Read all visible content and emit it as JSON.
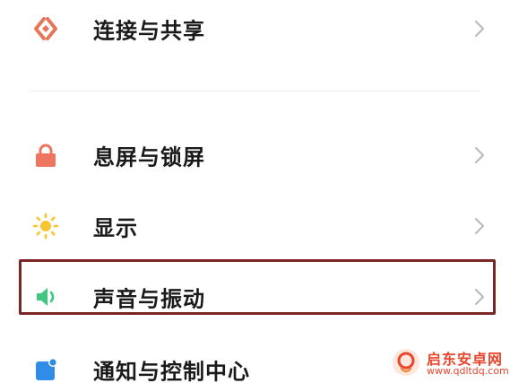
{
  "settings": {
    "items": [
      {
        "label": "连接与共享",
        "icon": "connection-sharing-icon"
      },
      {
        "label": "息屏与锁屏",
        "icon": "lock-icon"
      },
      {
        "label": "显示",
        "icon": "sun-icon"
      },
      {
        "label": "声音与振动",
        "icon": "speaker-icon",
        "highlighted": true
      },
      {
        "label": "通知与控制中心",
        "icon": "notification-icon"
      }
    ]
  },
  "watermark": {
    "name": "启东安卓网",
    "url": "www.qdltdq.com"
  },
  "colors": {
    "connection_icon": "#e4775b",
    "lock_icon": "#ef7563",
    "sun_icon": "#f6c531",
    "speaker_icon": "#3ec87f",
    "notification_icon": "#2f8de8",
    "highlight_border": "#7a2626",
    "watermark": "#e8452c"
  }
}
